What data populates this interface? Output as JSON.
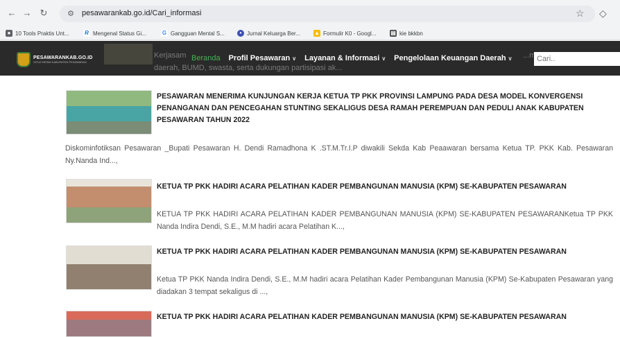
{
  "browser": {
    "url": "pesawarankab.go.id/Cari_informasi",
    "back_icon": "arrow-left-icon",
    "forward_icon": "arrow-right-icon",
    "reload_icon": "reload-icon",
    "site_info_icon": "tune-icon",
    "star_icon": "star-icon",
    "extension_icon": "puzzle-icon"
  },
  "bookmarks": [
    {
      "label": "10 Tools Praktis Unt...",
      "icon": "globe-icon",
      "color": "#5f6368"
    },
    {
      "label": "Mengenal Status Gi...",
      "icon": "r-logo-icon",
      "color": "#1a73e8"
    },
    {
      "label": "Gangguan Mental S...",
      "icon": "g-logo-icon",
      "color": "#4285f4"
    },
    {
      "label": "Jurnal Keluarga Ber...",
      "icon": "journal-icon",
      "color": "#3f51b5"
    },
    {
      "label": "Formulir K0 - Googl...",
      "icon": "drive-icon",
      "color": "#fbbc04"
    },
    {
      "label": "kie bkkbn",
      "icon": "document-icon",
      "color": "#444444"
    }
  ],
  "site": {
    "logo_title": "PESAWARANKAB.GO.ID",
    "logo_sub": "SITUS RESMI KABUPATEN PESAWARAN",
    "ghost_line1": "Kerjasam",
    "ghost_line1b": "...me",
    "ghost_line2": "daerah, BUMD, swasta, serta dukungan partisipasi ak...",
    "nav": [
      {
        "label": "Beranda",
        "dropdown": false
      },
      {
        "label": "Profil Pesawaran",
        "dropdown": true
      },
      {
        "label": "Layanan & Informasi",
        "dropdown": true
      },
      {
        "label": "Pengelolaan Keuangan Daerah",
        "dropdown": true
      }
    ],
    "search_placeholder": "Cari.."
  },
  "articles": [
    {
      "title": "PESAWARAN MENERIMA KUNJUNGAN KERJA KETUA TP PKK PROVINSI LAMPUNG PADA DESA MODEL KONVERGENSI PENANGANAN DAN PENCEGAHAN STUNTING SEKALIGUS DESA RAMAH PEREMPUAN DAN PEDULI ANAK KABUPATEN PESAWARAN TAHUN 2022",
      "excerpt": "Diskominfotiksan Pesawaran _Bupati Pesawaran H. Dendi Ramadhona K .ST.M.Tr.I.P diwakili Sekda Kab Peaawaran bersama Ketua TP. PKK Kab. Pesawaran Ny.Nanda Ind...,"
    },
    {
      "title": "KETUA TP PKK HADIRI ACARA PELATIHAN KADER PEMBANGUNAN MANUSIA (KPM) SE-KABUPATEN PESAWARAN",
      "excerpt": "KETUA TP PKK HADIRI ACARA PELATIHAN KADER PEMBANGUNAN MANUSIA (KPM) SE-KABUPATEN PESAWARANKetua TP PKK Nanda Indira Dendi, S.E., M.M hadiri acara Pelatihan K...,"
    },
    {
      "title": "KETUA TP PKK HADIRI ACARA PELATIHAN KADER PEMBANGUNAN MANUSIA (KPM) SE-KABUPATEN PESAWARAN",
      "excerpt": "Ketua TP PKK Nanda Indira Dendi, S.E., M.M hadiri acara Pelatihan Kader Pembangunan Manusia (KPM) Se-Kabupaten Pesawaran yang diadakan 3 tempat sekaligus di ...,"
    },
    {
      "title": "KETUA TP PKK HADIRI ACARA PELATIHAN KADER PEMBANGUNAN MANUSIA (KPM) SE-KABUPATEN PESAWARAN",
      "excerpt": ""
    }
  ]
}
